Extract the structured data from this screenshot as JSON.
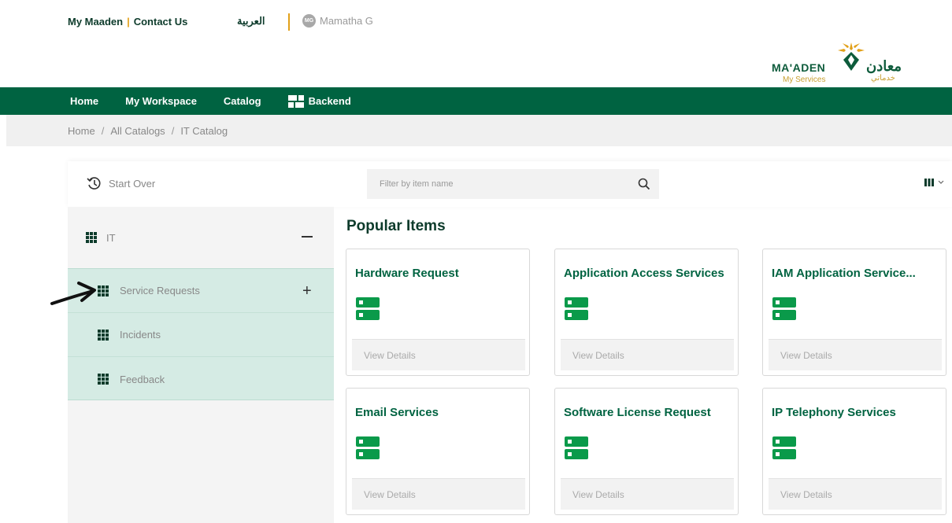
{
  "header": {
    "my_maaden": "My Maaden",
    "separator": "|",
    "contact_us": "Contact Us",
    "arabic": "العربية",
    "user_initials": "MG",
    "user_name": "Mamatha G",
    "logo_en": "MA'ADEN",
    "logo_sub_en": "My Services",
    "logo_ar": "معادن",
    "logo_sub_ar": "خدماتي"
  },
  "nav": {
    "home": "Home",
    "workspace": "My Workspace",
    "catalog": "Catalog",
    "backend": "Backend"
  },
  "breadcrumb": {
    "items": [
      "Home",
      "All Catalogs",
      "IT Catalog"
    ],
    "separator": "/"
  },
  "toolbar": {
    "start_over": "Start Over",
    "filter_placeholder": "Filter by item name"
  },
  "sidebar": {
    "category": "IT",
    "items": [
      "Service Requests",
      "Incidents",
      "Feedback"
    ]
  },
  "main": {
    "section_title": "Popular Items",
    "cards": [
      {
        "title": "Hardware Request",
        "action": "View Details"
      },
      {
        "title": "Application Access Services",
        "action": "View Details"
      },
      {
        "title": "IAM Application Service...",
        "action": "View Details"
      },
      {
        "title": "Email Services",
        "action": "View Details"
      },
      {
        "title": "Software License Request",
        "action": "View Details"
      },
      {
        "title": "IP Telephony Services",
        "action": "View Details"
      }
    ]
  },
  "colors": {
    "brand_green": "#006341",
    "accent_gold": "#e2a11a",
    "selected_bg": "#d5ebe4"
  }
}
